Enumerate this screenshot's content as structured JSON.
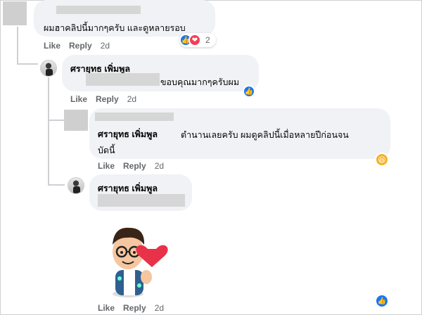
{
  "comments": [
    {
      "text": "ผมฮาคลิปนี้มากๆครับ และดูหลายรอบ",
      "reaction_count": "2"
    },
    {
      "author": "ศรายุทธ เพิ่มพูล",
      "text": "ขอบคุณมากๆครับผม"
    },
    {
      "author": "ศรายุทธ เพิ่มพูล",
      "text_line1": "ตำนานเลยครับ ผมดูคลิปนี้เมื่อหลายปีก่อนจน",
      "text_line2": "บัดนี้"
    },
    {
      "author": "ศรายุทธ เพิ่มพูล"
    }
  ],
  "actions": {
    "like": "Like",
    "reply": "Reply",
    "time": "2d"
  },
  "icons": [
    "like-reaction-icon",
    "love-reaction-icon",
    "haha-reaction-icon",
    "heart-sticker"
  ]
}
